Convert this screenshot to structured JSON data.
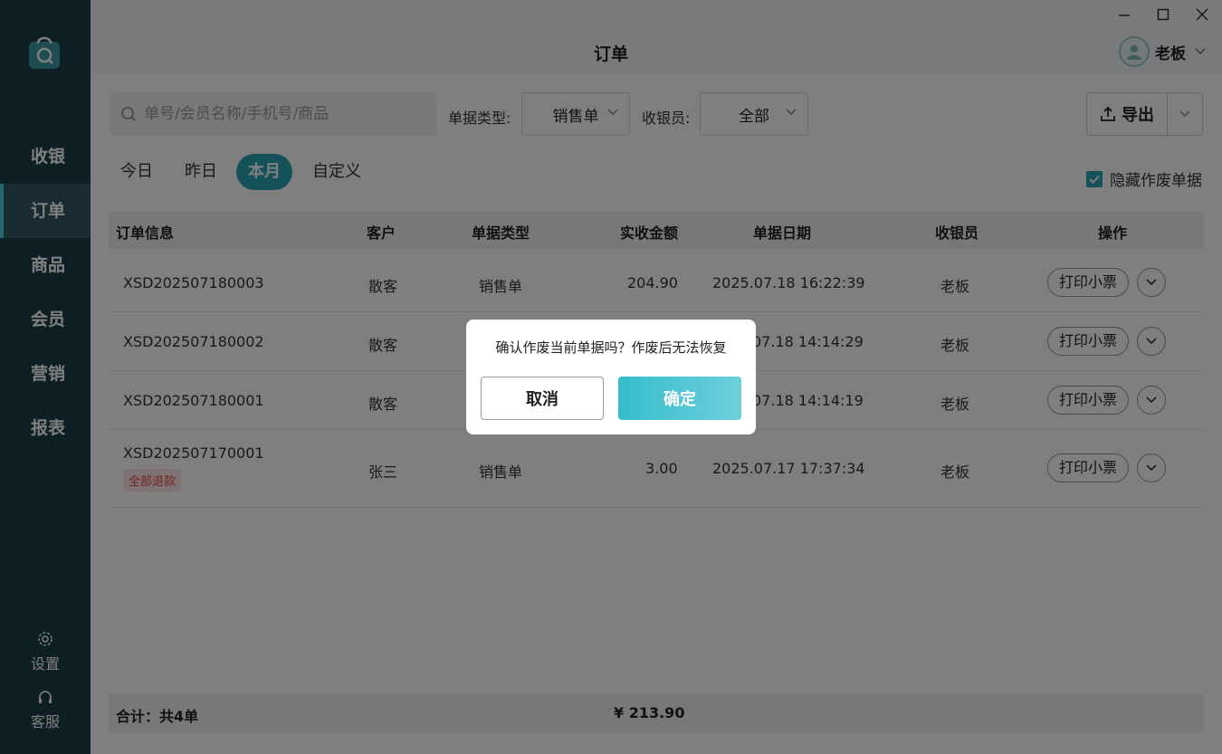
{
  "sidebar": {
    "items": [
      {
        "label": "收银"
      },
      {
        "label": "订单"
      },
      {
        "label": "商品"
      },
      {
        "label": "会员"
      },
      {
        "label": "营销"
      },
      {
        "label": "报表"
      }
    ],
    "settings_label": "设置",
    "service_label": "客服"
  },
  "header": {
    "title": "订单",
    "user_name": "老板"
  },
  "toolbar": {
    "search_placeholder": "单号/会员名称/手机号/商品",
    "doc_type_label": "单据类型:",
    "doc_type_value": "销售单",
    "cashier_label": "收银员:",
    "cashier_value": "全部",
    "export_label": "导出"
  },
  "date_tabs": [
    {
      "label": "今日"
    },
    {
      "label": "昨日"
    },
    {
      "label": "本月"
    },
    {
      "label": "自定义"
    }
  ],
  "hide_void_label": "隐藏作废单据",
  "table": {
    "headers": [
      "订单信息",
      "客户",
      "单据类型",
      "实收金额",
      "单据日期",
      "收银员",
      "操作"
    ],
    "rows": [
      {
        "order_no": "XSD202507180003",
        "customer": "散客",
        "type": "销售单",
        "amount": "204.90",
        "date": "2025.07.18 16:22:39",
        "cashier": "老板",
        "action": "打印小票"
      },
      {
        "order_no": "XSD202507180002",
        "customer": "散客",
        "type": "",
        "amount": "",
        "date": "07.18 14:14:29",
        "cashier": "老板",
        "action": "打印小票"
      },
      {
        "order_no": "XSD202507180001",
        "customer": "散客",
        "type": "",
        "amount": "",
        "date": "07.18 14:14:19",
        "cashier": "老板",
        "action": "打印小票"
      },
      {
        "order_no": "XSD202507170001",
        "badge": "全部退款",
        "customer": "张三",
        "type": "销售单",
        "amount": "3.00",
        "date": "2025.07.17 17:37:34",
        "cashier": "老板",
        "action": "打印小票"
      }
    ]
  },
  "footer": {
    "total_label": "合计：共4单",
    "total_amount": "¥ 213.90"
  },
  "dialog": {
    "message": "确认作废当前单据吗？作废后无法恢复",
    "cancel_label": "取消",
    "confirm_label": "确定"
  },
  "colors": {
    "sidebar_bg": "#1b3f47",
    "accent": "#2aa3b0",
    "refund_text": "#e04b4b"
  }
}
